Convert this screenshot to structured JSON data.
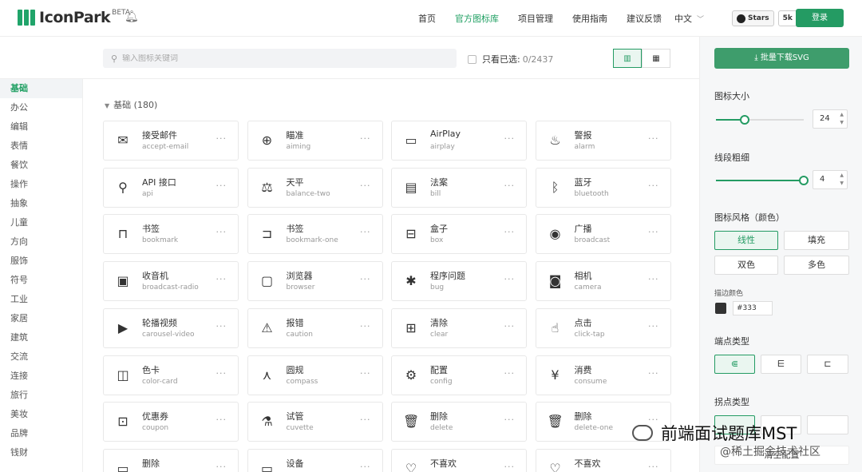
{
  "header": {
    "logo_text": "IconPark",
    "logo_badge": "BETA",
    "nav": [
      "首页",
      "官方图标库",
      "项目管理",
      "使用指南",
      "建议反馈"
    ],
    "nav_active": 1,
    "lang": "中文",
    "github_stars_label": "Stars",
    "github_stars_count": "5k",
    "login_label": "登录"
  },
  "search": {
    "placeholder": "输入图标关键词",
    "only_selected_label": "只看已选:",
    "selected_count": "0/2437"
  },
  "sidebar": {
    "items": [
      "基础",
      "办公",
      "编辑",
      "表情",
      "餐饮",
      "操作",
      "抽象",
      "儿童",
      "方向",
      "服饰",
      "符号",
      "工业",
      "家居",
      "建筑",
      "交流",
      "连接",
      "旅行",
      "美妆",
      "品牌",
      "钱财"
    ],
    "active": 0
  },
  "section": {
    "title": "基础 (180)"
  },
  "icons": [
    {
      "cn": "接受邮件",
      "en": "accept-email",
      "glyph": "✉"
    },
    {
      "cn": "瞄准",
      "en": "aiming",
      "glyph": "⊕"
    },
    {
      "cn": "AirPlay",
      "en": "airplay",
      "glyph": "▭"
    },
    {
      "cn": "警报",
      "en": "alarm",
      "glyph": "♨"
    },
    {
      "cn": "API 接口",
      "en": "api",
      "glyph": "⚲"
    },
    {
      "cn": "天平",
      "en": "balance-two",
      "glyph": "⚖"
    },
    {
      "cn": "法案",
      "en": "bill",
      "glyph": "▤"
    },
    {
      "cn": "蓝牙",
      "en": "bluetooth",
      "glyph": "ᛒ"
    },
    {
      "cn": "书签",
      "en": "bookmark",
      "glyph": "⊓"
    },
    {
      "cn": "书签",
      "en": "bookmark-one",
      "glyph": "⊐"
    },
    {
      "cn": "盒子",
      "en": "box",
      "glyph": "⊟"
    },
    {
      "cn": "广播",
      "en": "broadcast",
      "glyph": "◉"
    },
    {
      "cn": "收音机",
      "en": "broadcast-radio",
      "glyph": "▣"
    },
    {
      "cn": "浏览器",
      "en": "browser",
      "glyph": "▢"
    },
    {
      "cn": "程序问题",
      "en": "bug",
      "glyph": "✱"
    },
    {
      "cn": "相机",
      "en": "camera",
      "glyph": "◙"
    },
    {
      "cn": "轮播视频",
      "en": "carousel-video",
      "glyph": "▶"
    },
    {
      "cn": "报错",
      "en": "caution",
      "glyph": "⚠"
    },
    {
      "cn": "清除",
      "en": "clear",
      "glyph": "⊞"
    },
    {
      "cn": "点击",
      "en": "click-tap",
      "glyph": "☝"
    },
    {
      "cn": "色卡",
      "en": "color-card",
      "glyph": "◫"
    },
    {
      "cn": "圆规",
      "en": "compass",
      "glyph": "⋏"
    },
    {
      "cn": "配置",
      "en": "config",
      "glyph": "⚙"
    },
    {
      "cn": "消费",
      "en": "consume",
      "glyph": "¥"
    },
    {
      "cn": "优惠券",
      "en": "coupon",
      "glyph": "⊡"
    },
    {
      "cn": "试管",
      "en": "cuvette",
      "glyph": "⚗"
    },
    {
      "cn": "删除",
      "en": "delete",
      "glyph": "🗑"
    },
    {
      "cn": "删除",
      "en": "delete-one",
      "glyph": "🗑"
    },
    {
      "cn": "删除",
      "en": "",
      "glyph": "▭"
    },
    {
      "cn": "设备",
      "en": "",
      "glyph": "▭"
    },
    {
      "cn": "不喜欢",
      "en": "",
      "glyph": "♡"
    },
    {
      "cn": "不喜欢",
      "en": "",
      "glyph": "♡"
    }
  ],
  "panel": {
    "download_label": "批量下载SVG",
    "size_label": "图标大小",
    "size_value": "24",
    "size_fraction": 0.33,
    "stroke_label": "线段粗细",
    "stroke_value": "4",
    "stroke_fraction": 1.0,
    "style_label": "图标风格（颜色）",
    "styles": [
      "线性",
      "填充",
      "双色",
      "多色"
    ],
    "style_active": 0,
    "stroke_color_label": "描边颜色",
    "stroke_color": "#333",
    "endpoint_label": "端点类型",
    "joint_label": "拐点类型",
    "reset_label": "清空配置"
  },
  "watermark": {
    "line1": "前端面试题库MST",
    "line2": "@稀土掘金技术社区"
  },
  "colors": {
    "brand": "#249b63",
    "active_text": "#1f9f62"
  }
}
